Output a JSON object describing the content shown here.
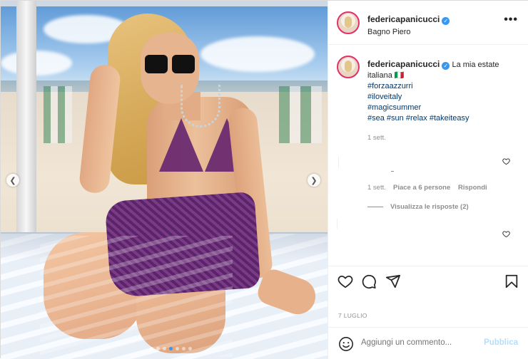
{
  "post": {
    "username": "federicapanicucci",
    "location": "Bagno Piero",
    "caption_text": "La mia estate italiana 🇮🇹",
    "hashtags_lines": [
      "#forzaazzurri",
      "#iloveitaly",
      "#magicsummer"
    ],
    "hashtags_last": [
      "#sea",
      "#sun",
      "#relax",
      "#takeiteasy"
    ],
    "caption_time": "1 sett.",
    "date": "7 LUGLIO"
  },
  "comment": {
    "time": "1 sett.",
    "likes": "Piace a 6 persone",
    "reply": "Rispondi",
    "view_replies": "Visualizza le risposte (2)"
  },
  "header": {
    "more_label": "•••"
  },
  "comment_box": {
    "placeholder": "Aggiungi un commento...",
    "publish": "Pubblica"
  },
  "carousel": {
    "total": 7,
    "current": 4
  },
  "colors": {
    "link": "#00376b",
    "accent": "#3897f0",
    "muted": "#8e8e8e"
  },
  "icons": {
    "like": "heart-icon",
    "comment": "comment-icon",
    "share": "share-icon",
    "save": "bookmark-icon",
    "emoji": "emoji-icon",
    "more": "more-icon"
  }
}
